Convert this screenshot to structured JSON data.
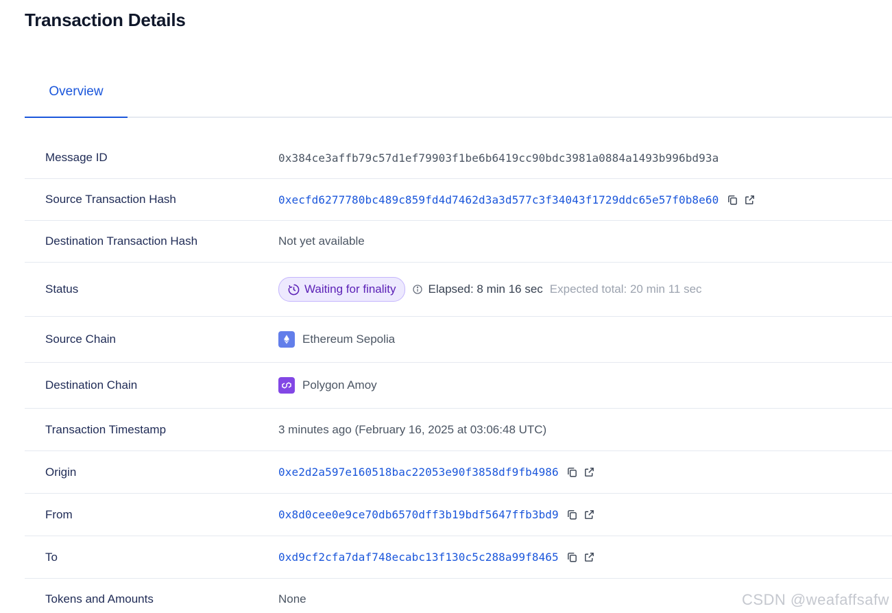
{
  "page": {
    "title": "Transaction Details"
  },
  "tabs": [
    {
      "label": "Overview",
      "active": true
    }
  ],
  "rows": {
    "message_id": {
      "label": "Message ID",
      "value": "0x384ce3affb79c57d1ef79903f1be6b6419cc90bdc3981a0884a1493b996bd93a"
    },
    "source_tx_hash": {
      "label": "Source Transaction Hash",
      "value": "0xecfd6277780bc489c859fd4d7462d3a3d577c3f34043f1729ddc65e57f0b8e60"
    },
    "destination_tx_hash": {
      "label": "Destination Transaction Hash",
      "value": "Not yet available"
    },
    "status": {
      "label": "Status",
      "badge": "Waiting for finality",
      "elapsed": "Elapsed: 8 min 16 sec",
      "expected": "Expected total: 20 min 11 sec"
    },
    "source_chain": {
      "label": "Source Chain",
      "value": "Ethereum Sepolia",
      "icon": "ethereum-icon"
    },
    "destination_chain": {
      "label": "Destination Chain",
      "value": "Polygon Amoy",
      "icon": "polygon-icon"
    },
    "timestamp": {
      "label": "Transaction Timestamp",
      "value": "3 minutes ago (February 16, 2025 at 03:06:48 UTC)"
    },
    "origin": {
      "label": "Origin",
      "value": "0xe2d2a597e160518bac22053e90f3858df9fb4986"
    },
    "from": {
      "label": "From",
      "value": "0x8d0cee0e9ce70db6570dff3b19bdf5647ffb3bd9"
    },
    "to": {
      "label": "To",
      "value": "0xd9cf2cfa7daf748ecabc13f130c5c288a99f8465"
    },
    "tokens": {
      "label": "Tokens and Amounts",
      "value": "None"
    }
  },
  "colors": {
    "link": "#1a56db",
    "status_bg": "#ede9fe",
    "status_text": "#5b21b6",
    "ethereum": "#627eea",
    "polygon": "#8247e5"
  },
  "watermark": "CSDN @weafaffsafw"
}
